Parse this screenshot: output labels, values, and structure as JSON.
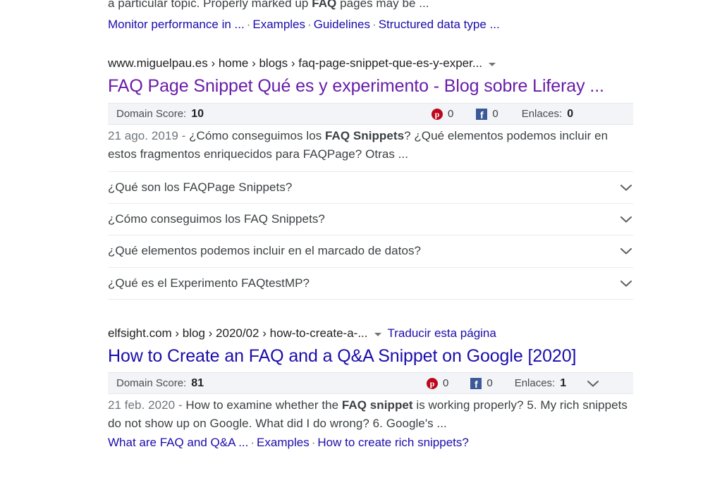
{
  "top_partial_result": {
    "snippet_pre": "a particular topic. Properly marked up ",
    "snippet_bold": "FAQ",
    "snippet_post": " pages may be ...",
    "sitelinks": [
      "Monitor performance in ...",
      "Examples",
      "Guidelines",
      "Structured data type ..."
    ],
    "separator": "·"
  },
  "result_one": {
    "breadcrumb": "www.miguelpau.es › home › blogs › faq-page-snippet-que-es-y-exper...",
    "caret_icon": "chevron-down-icon",
    "title": "FAQ Page Snippet Qué es y experimento - Blog sobre Liferay ...",
    "title_state": "visited",
    "score_bar": {
      "domain_score_label": "Domain Score:",
      "domain_score_value": "10",
      "pinterest_icon": "pinterest-icon",
      "pinterest_glyph": "p",
      "pinterest_count": "0",
      "facebook_icon": "facebook-icon",
      "facebook_glyph": "f",
      "facebook_count": "0",
      "links_label": "Enlaces:",
      "links_value": "0",
      "has_expand_chevron": false
    },
    "snippet_date": "21 ago. 2019 - ",
    "snippet_pre": "¿Cómo conseguimos los ",
    "snippet_bold": "FAQ Snippets",
    "snippet_post": "? ¿Qué elementos podemos incluir en estos fragmentos enriquecidos para FAQPage? Otras ...",
    "faq_items": [
      "¿Qué son los FAQPage Snippets?",
      "¿Cómo conseguimos los FAQ Snippets?",
      "¿Qué elementos podemos incluir en el marcado de datos?",
      "¿Qué es el Experimento FAQtestMP?"
    ],
    "faq_chevron_icon": "chevron-down-icon"
  },
  "result_two": {
    "breadcrumb": "elfsight.com › blog › 2020/02 › how-to-create-a-...",
    "caret_icon": "chevron-down-icon",
    "translate_link": "Traducir esta página",
    "title": "How to Create an FAQ and a Q&A Snippet on Google [2020]",
    "title_state": "unvisited",
    "score_bar": {
      "domain_score_label": "Domain Score:",
      "domain_score_value": "81",
      "pinterest_icon": "pinterest-icon",
      "pinterest_glyph": "p",
      "pinterest_count": "0",
      "facebook_icon": "facebook-icon",
      "facebook_glyph": "f",
      "facebook_count": "0",
      "links_label": "Enlaces:",
      "links_value": "1",
      "has_expand_chevron": true,
      "expand_chevron_icon": "chevron-down-icon"
    },
    "snippet_date": "21 feb. 2020 - ",
    "snippet_pre": "How to examine whether the ",
    "snippet_bold": "FAQ snippet",
    "snippet_post": " is working properly? 5. My rich snippets do not show up on Google. What did I do wrong? 6. Google's ...",
    "sitelinks": [
      "What are FAQ and Q&A ...",
      "Examples",
      "How to create rich snippets?"
    ],
    "separator": "·"
  },
  "colors": {
    "link_blue": "#1a0dab",
    "visited_purple": "#681da8",
    "body_text": "#3c4043",
    "muted_text": "#70757a",
    "score_bar_bg": "#f3f4f7",
    "divider": "#ebebeb",
    "pinterest_red": "#bd081c",
    "facebook_blue": "#3b5998"
  }
}
